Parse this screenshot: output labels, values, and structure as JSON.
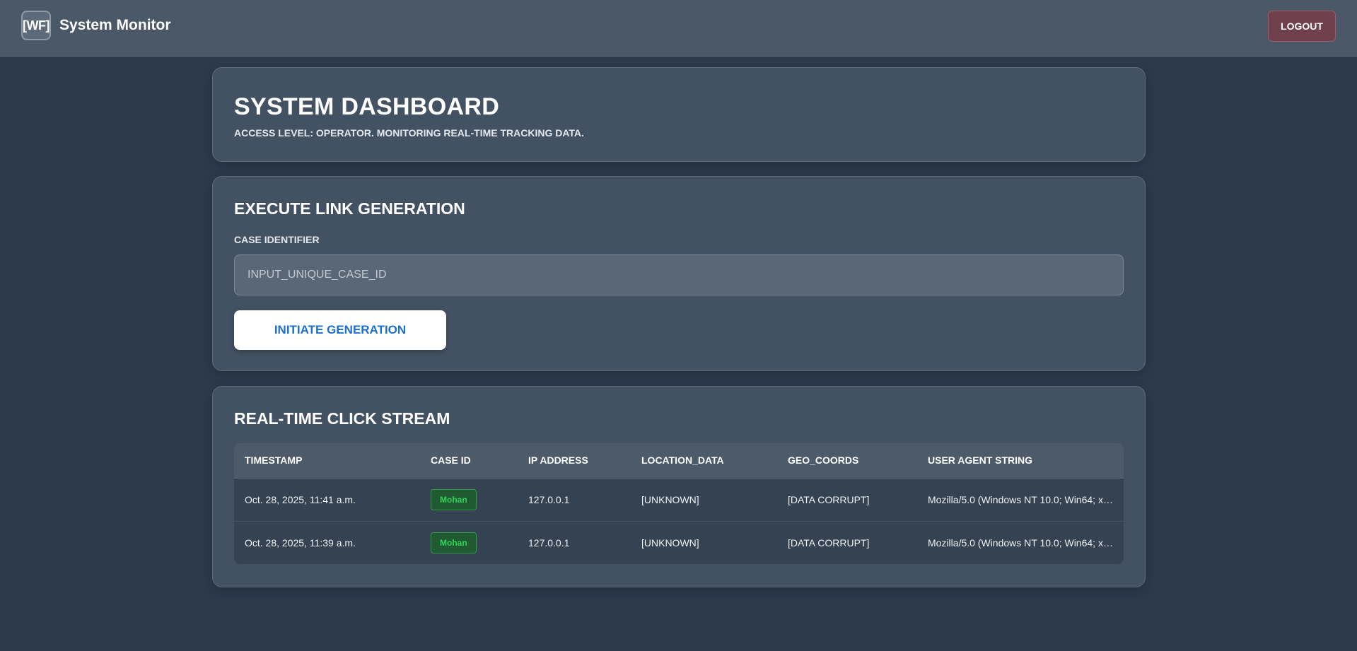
{
  "header": {
    "logo_text": "[WF]",
    "title": "System Monitor",
    "logout_label": "LOGOUT"
  },
  "dashboard": {
    "title": "SYSTEM DASHBOARD",
    "subtitle": "ACCESS LEVEL: OPERATOR. MONITORING REAL-TIME TRACKING DATA."
  },
  "generator": {
    "title": "EXECUTE LINK GENERATION",
    "field_label": "CASE IDENTIFIER",
    "input_placeholder": "INPUT_UNIQUE_CASE_ID",
    "input_value": "",
    "button_label": "INITIATE GENERATION"
  },
  "stream": {
    "title": "REAL-TIME CLICK STREAM",
    "columns": [
      "TIMESTAMP",
      "CASE ID",
      "IP ADDRESS",
      "LOCATION_DATA",
      "GEO_COORDS",
      "USER AGENT STRING"
    ],
    "rows": [
      {
        "timestamp": "Oct. 28, 2025, 11:41 a.m.",
        "case_id": "Mohan",
        "ip": "127.0.0.1",
        "location": "[UNKNOWN]",
        "geo": "[DATA CORRUPT]",
        "user_agent": "Mozilla/5.0 (Windows NT 10.0; Win64; x6..."
      },
      {
        "timestamp": "Oct. 28, 2025, 11:39 a.m.",
        "case_id": "Mohan",
        "ip": "127.0.0.1",
        "location": "[UNKNOWN]",
        "geo": "[DATA CORRUPT]",
        "user_agent": "Mozilla/5.0 (Windows NT 10.0; Win64; x6..."
      }
    ]
  },
  "colors": {
    "page_background": "#2c3a4c",
    "header_background": "#4a5868",
    "card_background": "#435263",
    "logout_background": "#71404d",
    "button_text": "#1a6fd0",
    "badge_text": "#33d35a"
  }
}
